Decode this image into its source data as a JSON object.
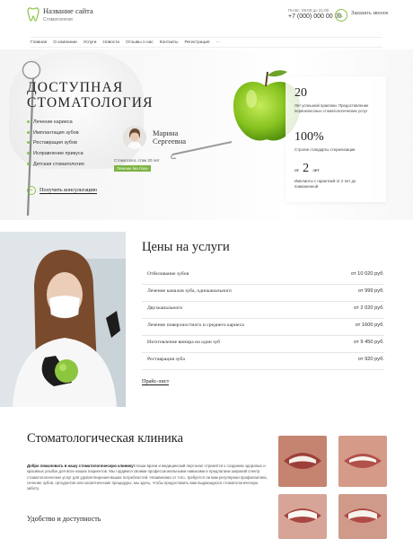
{
  "header": {
    "site_name": "Название сайта",
    "site_sub": "Стоматология",
    "hours": "Пн-Вс: 09:00 до 21:00",
    "phone": "+7 (000) 000 00 00",
    "call_label": "Заказать звонок"
  },
  "nav": [
    "Главная",
    "О компании",
    "Услуги",
    "Новости",
    "Отзывы о нас",
    "Контакты",
    "Регистрация",
    "···"
  ],
  "hero": {
    "title_line1": "ДОСТУПНАЯ",
    "title_line2": "СТОМАТОЛОГИЯ",
    "features": [
      "Лечение кариеса",
      "Имплантация зубов",
      "Реставрация зубов",
      "Исправление прикуса",
      "Детская стоматология"
    ],
    "consult_label": "Получить консультацию",
    "doctor_first": "Марина",
    "doctor_last": "Сергеевна",
    "doctor_exp": "Стоматолог, стаж 20 лет",
    "doctor_badge": "Лечение без боли"
  },
  "stats": {
    "s1_value": "20",
    "s1_text": "Лет успешной практики. Предоставление первоклассных стоматологических услуг",
    "s2_value": "100%",
    "s2_text": "Строгие стандарты стерилизации",
    "s3_prefix": "от",
    "s3_value": "2",
    "s3_suffix": "лет",
    "s3_text": "Импланты с гарантией от 2 лет до пожизненной"
  },
  "prices": {
    "title": "Цены на услуги",
    "rows": [
      {
        "name": "Отбеливание зубов",
        "value": "от 10 020 руб."
      },
      {
        "name": "Лечение каналов зуба, одноканального",
        "value": "от 999 руб."
      },
      {
        "name": "Двухканального",
        "value": "от 2 020 руб."
      },
      {
        "name": "Лечение поверхностного и среднего кариеса",
        "value": "от 1600 руб."
      },
      {
        "name": "Изготовление винира на один зуб",
        "value": "от 9 450 руб."
      },
      {
        "name": "Реставрация зуба",
        "value": "от 920 руб."
      }
    ],
    "link": "Прайс-лист"
  },
  "clinic": {
    "title": "Стоматологическая клиника",
    "lead": "Добро пожаловать в нашу стоматологическую клинику!",
    "text": "Наши врачи и медицинский персонал стремятся к созданию здоровых и красивых улыбок для всех наших пациентов. Мы гордимся своими профессиональными навыками и предлагаем широкий спектр стоматологических услуг для удовлетворения ваших потребностей. Независимо от того, требуется ли вам регулярная профилактика, лечение зубов, ортодонтия или косметические процедуры, мы здесь, чтобы предоставить вам выдающуюся стоматологическую заботу.",
    "feature_title": "Удобство и доступность"
  },
  "colors": {
    "accent": "#8bc34a"
  }
}
